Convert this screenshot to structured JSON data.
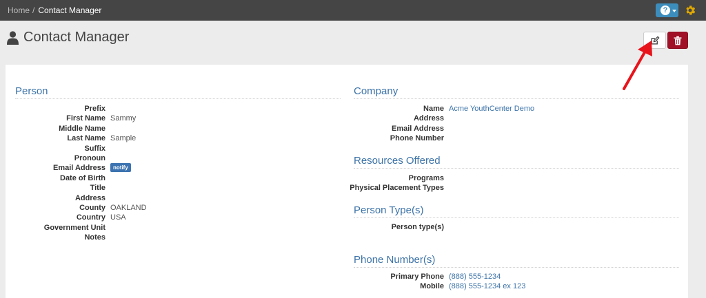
{
  "breadcrumb": {
    "home": "Home",
    "separator": "/",
    "current": "Contact Manager"
  },
  "header": {
    "title": "Contact Manager",
    "title_icon": "person-icon",
    "help_icon": "question-circle-icon",
    "settings_icon": "gear-icon",
    "edit_icon": "edit-icon",
    "delete_icon": "trash-icon"
  },
  "colors": {
    "topbar": "#454545",
    "accent": "#3c73a8",
    "help": "#3c8dbc",
    "danger": "#a01127",
    "annotation_arrow": "#e8141c"
  },
  "person": {
    "title": "Person",
    "fields": [
      {
        "label": "Prefix",
        "value": ""
      },
      {
        "label": "First Name",
        "value": "Sammy"
      },
      {
        "label": "Middle Name",
        "value": ""
      },
      {
        "label": "Last Name",
        "value": "Sample"
      },
      {
        "label": "Suffix",
        "value": ""
      },
      {
        "label": "Pronoun",
        "value": ""
      },
      {
        "label": "Email Address",
        "value": "",
        "badge": "notify"
      },
      {
        "label": "Date of Birth",
        "value": ""
      },
      {
        "label": "Title",
        "value": ""
      },
      {
        "label": "Address",
        "value": ""
      },
      {
        "label": "County",
        "value": "OAKLAND"
      },
      {
        "label": "Country",
        "value": "USA"
      },
      {
        "label": "Government Unit",
        "value": ""
      },
      {
        "label": "Notes",
        "value": ""
      }
    ]
  },
  "company": {
    "title": "Company",
    "fields": [
      {
        "label": "Name",
        "value": "Acme YouthCenter Demo"
      },
      {
        "label": "Address",
        "value": ""
      },
      {
        "label": "Email Address",
        "value": ""
      },
      {
        "label": "Phone Number",
        "value": ""
      }
    ]
  },
  "resources": {
    "title": "Resources Offered",
    "fields": [
      {
        "label": "Programs",
        "value": ""
      },
      {
        "label": "Physical Placement Types",
        "value": ""
      }
    ]
  },
  "person_types": {
    "title": "Person Type(s)",
    "fields": [
      {
        "label": "Person type(s)",
        "value": ""
      }
    ]
  },
  "phones": {
    "title": "Phone Number(s)",
    "fields": [
      {
        "label": "Primary Phone",
        "value": "(888) 555-1234"
      },
      {
        "label": "Mobile",
        "value": "(888) 555-1234 ex 123"
      }
    ]
  }
}
